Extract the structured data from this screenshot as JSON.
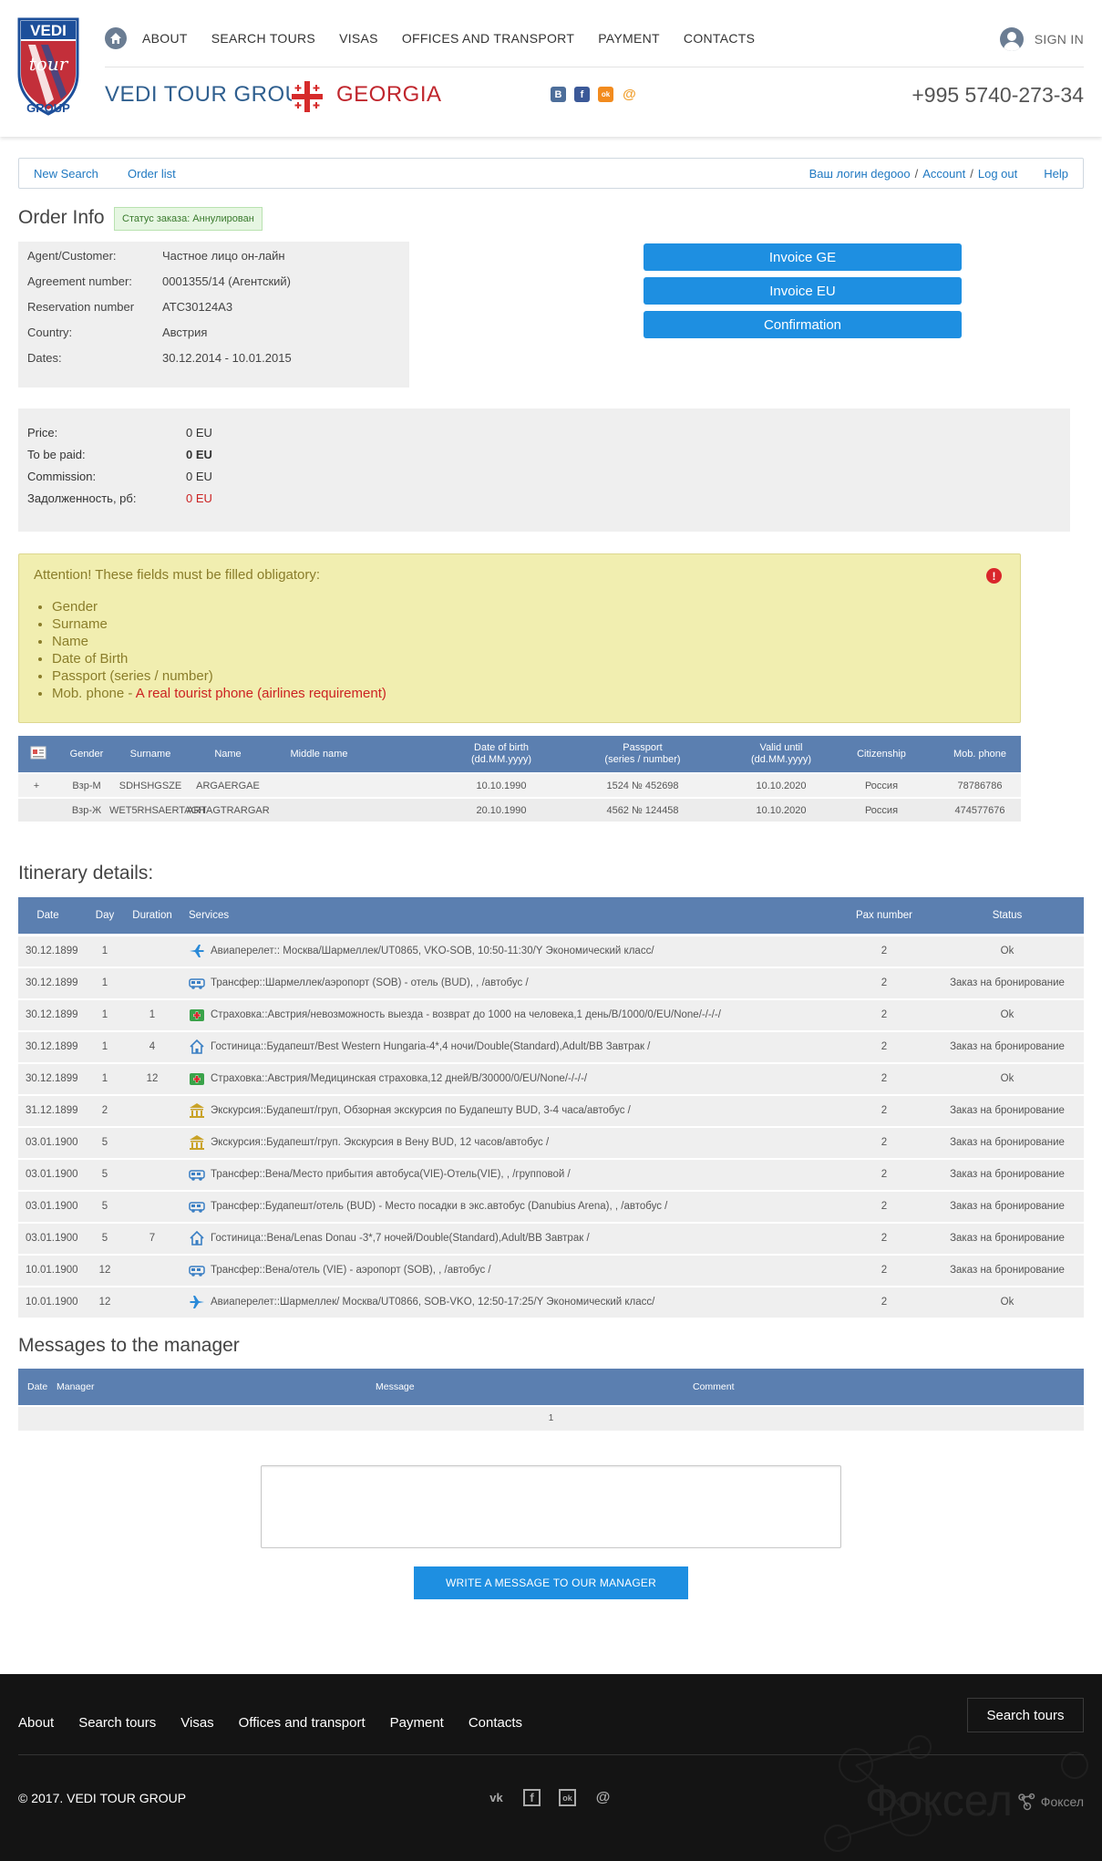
{
  "header": {
    "logo_text": [
      "VEDI",
      "tour",
      "GROUP"
    ],
    "nav": [
      "ABOUT",
      "SEARCH TOURS",
      "VISAS",
      "OFFICES AND TRANSPORT",
      "PAYMENT",
      "CONTACTS"
    ],
    "sign_in": "SIGN IN",
    "brand": "VEDI TOUR GROUP",
    "country": "GEORGIA",
    "socials": [
      "В",
      "f",
      "ok",
      "@"
    ],
    "phone": "+995 5740-273-34",
    "brand_color": "#2f5f8f",
    "country_color": "#c0262d"
  },
  "subnav": {
    "new_search": "New Search",
    "order_list": "Order list",
    "login_label": "Ваш логин degooo",
    "account": "Account",
    "log_out": "Log out",
    "help": "Help",
    "sep": "/"
  },
  "order": {
    "title": "Order Info",
    "status": "Статус заказа: Аннулирован",
    "fields": [
      {
        "label": "Agent/Customer:",
        "value": "Частное лицо он-лайн"
      },
      {
        "label": "Agreement number:",
        "value": "0001355/14 (Агентский)"
      },
      {
        "label": "Reservation number",
        "value": "ATC30124A3"
      },
      {
        "label": "Country:",
        "value": "Австрия"
      },
      {
        "label": "Dates:",
        "value": "30.12.2014  -  10.01.2015"
      }
    ],
    "buttons": [
      "Invoice GE",
      "Invoice EU",
      "Confirmation"
    ],
    "prices": [
      {
        "label": "Price:",
        "value": "0 EU"
      },
      {
        "label": "To be paid:",
        "value": "0 EU"
      },
      {
        "label": "Commission:",
        "value": "0 EU"
      },
      {
        "label": "Задолженность, рб:",
        "value": "0 EU"
      }
    ]
  },
  "attention": {
    "title": "Attention! These fields must be filled obligatory:",
    "items": [
      "Gender",
      "Surname",
      "Name",
      "Date of Birth",
      "Passport (series / number)",
      "Mob. phone - "
    ],
    "phone_note": "A real tourist phone (airlines requirement)",
    "icon": "!"
  },
  "tourists": {
    "headers": [
      "Gender",
      "Surname",
      "Name",
      "Middle name",
      "Date of birth\n(dd.MM.yyyy)",
      "Passport\n(series / number)",
      "Valid until\n(dd.MM.yyyy)",
      "Citizenship",
      "Mob. phone"
    ],
    "rows": [
      {
        "mark": "+",
        "gender": "Взр-М",
        "surname": "SDHSHGSZE",
        "name": "ARGAERGAE",
        "middle": "",
        "dob": "10.10.1990",
        "passport": "1524 № 452698",
        "valid": "10.10.2020",
        "citizenship": "Россия",
        "phone": "78786786"
      },
      {
        "mark": "",
        "gender": "Взр-Ж",
        "surname": "WET5RHSAERTAGH",
        "name": "ARTAGTRARGAR",
        "middle": "",
        "dob": "20.10.1990",
        "passport": "4562 № 124458",
        "valid": "10.10.2020",
        "citizenship": "Россия",
        "phone": "474577676"
      }
    ]
  },
  "itinerary": {
    "title": "Itinerary details:",
    "headers": [
      "Date",
      "Day",
      "Duration",
      "Services",
      "Pax number",
      "Status"
    ],
    "rows": [
      {
        "date": "30.12.1899",
        "day": "1",
        "duration": "",
        "icon": "plane-icon",
        "service": "Авиаперелет:: Москва/Шармеллек/UT0865, VKO-SOB, 10:50-11:30/Y Экономический класс/",
        "pax": "2",
        "status": "Ok"
      },
      {
        "date": "30.12.1899",
        "day": "1",
        "duration": "",
        "icon": "bus-icon",
        "service": "Трансфер::Шармеллек/аэропорт (SOB) - отель (BUD), , /автобус /",
        "pax": "2",
        "status": "Заказ на бронирование"
      },
      {
        "date": "30.12.1899",
        "day": "1",
        "duration": "1",
        "icon": "medical-icon",
        "service": "Страховка::Австрия/невозможность выезда - возврат до 1000 на человека,1 день/B/1000/0/EU/None/-/-/-/",
        "pax": "2",
        "status": "Ok"
      },
      {
        "date": "30.12.1899",
        "day": "1",
        "duration": "4",
        "icon": "house-icon",
        "service": "Гостиница::Будапешт/Best Western Hungaria-4*,4 ночи/Double(Standard),Adult/BB Завтрак /",
        "pax": "2",
        "status": "Заказ на бронирование"
      },
      {
        "date": "30.12.1899",
        "day": "1",
        "duration": "12",
        "icon": "medical-icon",
        "service": "Страховка::Австрия/Медицинская страховка,12 дней/B/30000/0/EU/None/-/-/-/",
        "pax": "2",
        "status": "Ok"
      },
      {
        "date": "31.12.1899",
        "day": "2",
        "duration": "",
        "icon": "museum-icon",
        "service": "Экскурсия::Будапешт/груп, Обзорная экскурсия по Будапешту BUD, 3-4 часа/автобус /",
        "pax": "2",
        "status": "Заказ на бронирование"
      },
      {
        "date": "03.01.1900",
        "day": "5",
        "duration": "",
        "icon": "museum-icon",
        "service": "Экскурсия::Будапешт/груп. Экскурсия в Вену BUD, 12 часов/автобус /",
        "pax": "2",
        "status": "Заказ на бронирование"
      },
      {
        "date": "03.01.1900",
        "day": "5",
        "duration": "",
        "icon": "bus-icon",
        "service": "Трансфер::Вена/Место прибытия автобуса(VIE)-Отель(VIE), , /групповой /",
        "pax": "2",
        "status": "Заказ на бронирование"
      },
      {
        "date": "03.01.1900",
        "day": "5",
        "duration": "",
        "icon": "bus-icon",
        "service": "Трансфер::Будапешт/отель (BUD) - Место посадки в экс.автобус (Danubius Arena), , /автобус /",
        "pax": "2",
        "status": "Заказ на бронирование"
      },
      {
        "date": "03.01.1900",
        "day": "5",
        "duration": "7",
        "icon": "house-icon",
        "service": "Гостиница::Вена/Lenas Donau -3*,7 ночей/Double(Standard),Adult/BB Завтрак /",
        "pax": "2",
        "status": "Заказ на бронирование"
      },
      {
        "date": "10.01.1900",
        "day": "12",
        "duration": "",
        "icon": "bus-icon",
        "service": "Трансфер::Вена/отель (VIE) - аэропорт (SOB), , /автобус /",
        "pax": "2",
        "status": "Заказ на бронирование"
      },
      {
        "date": "10.01.1900",
        "day": "12",
        "duration": "",
        "icon": "plane-back-icon",
        "service": "Авиаперелет::Шармеллек/ Москва/UT0866, SOB-VKO, 12:50-17:25/Y Экономический класс/",
        "pax": "2",
        "status": "Ok"
      }
    ]
  },
  "messages": {
    "title": "Messages to the manager",
    "headers": [
      "Date",
      "Manager",
      "Message",
      "Comment"
    ],
    "page": "1",
    "button": "WRITE A MESSAGE TO OUR MANAGER"
  },
  "footer": {
    "nav": [
      "About",
      "Search tours",
      "Visas",
      "Offices and transport",
      "Payment",
      "Contacts"
    ],
    "search_button": "Search tours",
    "copyright": "© 2017. VEDI TOUR GROUP",
    "socials": [
      "vk",
      "f",
      "ok",
      "@"
    ],
    "dev": "Фоксел",
    "watermark": "Фоксел"
  },
  "colors": {
    "accent": "#1e8fe1",
    "table_header": "#5b7fb0",
    "footer_bg": "#141414",
    "warning_bg": "#f1eeb0"
  }
}
